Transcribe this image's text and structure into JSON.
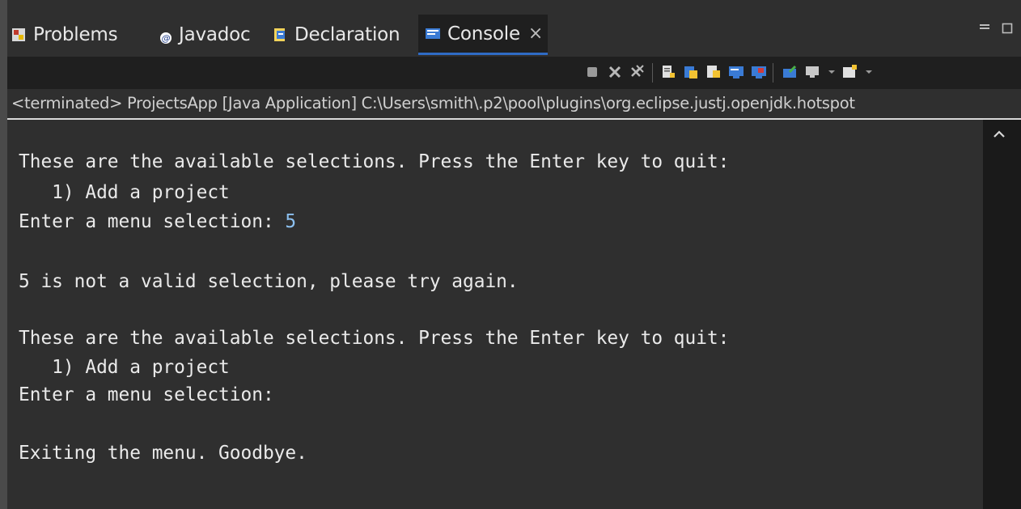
{
  "tabs": [
    {
      "label": "Problems",
      "icon": "problems-icon"
    },
    {
      "label": "Javadoc",
      "icon": "javadoc-icon"
    },
    {
      "label": "Declaration",
      "icon": "declaration-icon"
    },
    {
      "label": "Console",
      "icon": "console-icon",
      "active": true
    }
  ],
  "close_glyph": "×",
  "view_controls": {
    "minimize": "▭",
    "maximize": "▢"
  },
  "toolbar_icons": [
    "terminate-icon",
    "remove-launch-icon",
    "remove-all-terminated-icon",
    "scroll-lock-icon",
    "word-wrap-icon",
    "show-console-on-output-icon",
    "show-console-stdout-icon",
    "show-console-stderr-icon",
    "pin-console-icon",
    "display-selected-console-icon",
    "open-console-icon"
  ],
  "status": "<terminated> ProjectsApp [Java Application] C:\\Users\\smith\\.p2\\pool\\plugins\\org.eclipse.justj.openjdk.hotspot",
  "console": {
    "line1": "These are the available selections. Press the Enter key to quit:",
    "line2": "   1) Add a project",
    "line3_prompt": "Enter a menu selection: ",
    "line3_input": "5",
    "line4": "5 is not a valid selection, please try again.",
    "line5": "These are the available selections. Press the Enter key to quit:",
    "line6": "   1) Add a project",
    "line7": "Enter a menu selection:",
    "line8": "Exiting the menu. Goodbye."
  },
  "colors": {
    "background": "#2f2f2f",
    "toolbar": "#1f1f1f",
    "active_tab_underline": "#2f6bc4",
    "input_text": "#8cc0f0"
  }
}
